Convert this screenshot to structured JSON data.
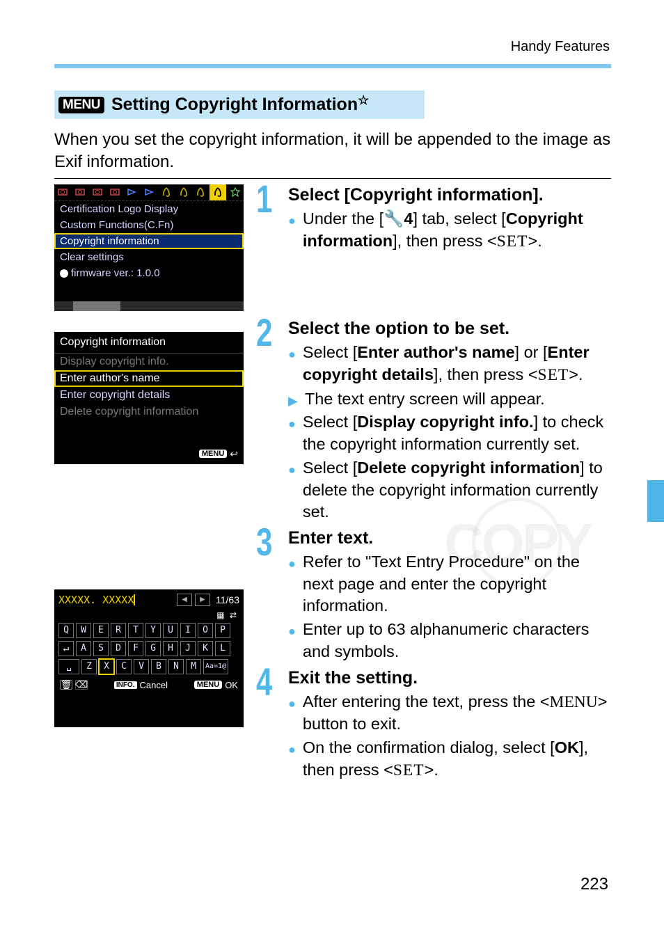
{
  "header": {
    "chapter": "Handy Features"
  },
  "section": {
    "menu_badge": "MENU",
    "title": "Setting Copyright Information",
    "star": "☆"
  },
  "intro": "When you set the copyright information, it will be appended to the image as Exif information.",
  "screens": {
    "menu1": {
      "items": [
        "Certification Logo Display",
        "Custom Functions(C.Fn)",
        "Copyright information",
        "Clear settings",
        "firmware ver.: 1.0.0"
      ],
      "highlighted_index": 2
    },
    "menu2": {
      "title": "Copyright information",
      "options": [
        {
          "label": "Display copyright info.",
          "enabled": false
        },
        {
          "label": "Enter author's name",
          "enabled": true,
          "highlighted": true
        },
        {
          "label": "Enter copyright details",
          "enabled": true
        },
        {
          "label": "Delete copyright information",
          "enabled": false
        }
      ],
      "back_label": "MENU"
    },
    "keyboard": {
      "entered": "XXXXX. XXXXX",
      "counter": "11/63",
      "rows": [
        [
          "Q",
          "W",
          "E",
          "R",
          "T",
          "Y",
          "U",
          "I",
          "O",
          "P"
        ],
        [
          "A",
          "S",
          "D",
          "F",
          "G",
          "H",
          "J",
          "K",
          "L"
        ],
        [
          "Z",
          "X",
          "C",
          "V",
          "B",
          "N",
          "M"
        ]
      ],
      "highlighted_key": "X",
      "mode_key": "Aa=1@",
      "info_label": "INFO.",
      "cancel_label": "Cancel",
      "menu_label": "MENU",
      "ok_label": "OK"
    }
  },
  "steps": [
    {
      "n": "1",
      "title": "Select [Copyright information].",
      "bullets": [
        {
          "type": "dot",
          "html": "Under the [🔧<b>4</b>] tab, select [<b>Copyright information</b>], then press <<span class='setkey'>SET</span>>."
        }
      ]
    },
    {
      "n": "2",
      "title": "Select the option to be set.",
      "bullets": [
        {
          "type": "dot",
          "html": "Select [<b>Enter author's name</b>] or [<b>Enter copyright details</b>], then press <<span class='setkey'>SET</span>>."
        },
        {
          "type": "arrow",
          "html": "The text entry screen will appear."
        },
        {
          "type": "dot",
          "html": "Select [<b>Display copyright info.</b>] to check the copyright information currently set."
        },
        {
          "type": "dot",
          "html": "Select [<b>Delete copyright information</b>] to delete the copyright information currently set."
        }
      ]
    },
    {
      "n": "3",
      "title": "Enter text.",
      "bullets": [
        {
          "type": "dot",
          "html": "Refer to \"Text Entry Procedure\" on the next page and enter the copyright information."
        },
        {
          "type": "dot",
          "html": "Enter up to 63 alphanumeric characters and symbols."
        }
      ]
    },
    {
      "n": "4",
      "title": "Exit the setting.",
      "bullets": [
        {
          "type": "dot",
          "html": "After entering the text, press the <<span class='menukey'>MENU</span>> button to exit."
        },
        {
          "type": "dot",
          "html": "On the confirmation dialog, select [<b>OK</b>], then press <<span class='setkey'>SET</span>>."
        }
      ]
    }
  ],
  "page_number": "223"
}
